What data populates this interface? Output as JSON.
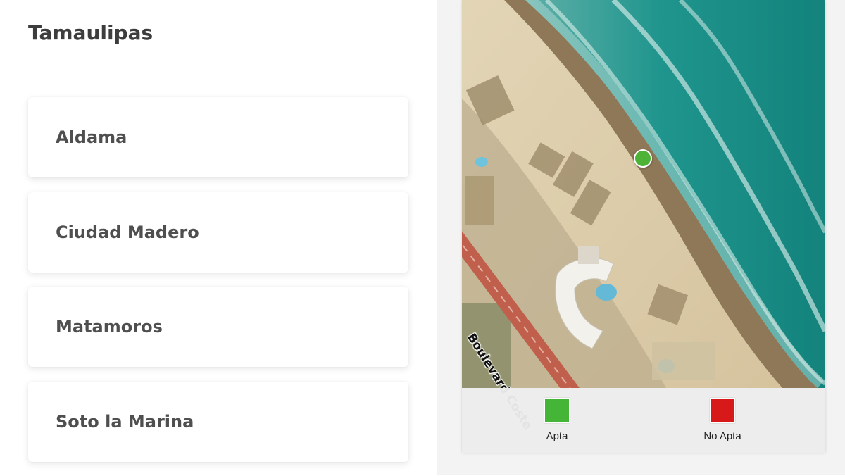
{
  "title": "Tamaulipas",
  "municipalities": [
    {
      "label": "Aldama"
    },
    {
      "label": "Ciudad Madero"
    },
    {
      "label": "Matamoros"
    },
    {
      "label": "Soto la Marina"
    }
  ],
  "map": {
    "road_label": "Boulevard Coste",
    "marker": {
      "status": "apta",
      "color": "#4cb336"
    },
    "legend": [
      {
        "label": "Apta",
        "color": "#45b537"
      },
      {
        "label": "No Apta",
        "color": "#d71919"
      }
    ]
  },
  "colors": {
    "ocean": "#1a8f88",
    "sand": "#d9c9a6",
    "wet_sand": "#8c7557",
    "road": "#c4644f"
  }
}
